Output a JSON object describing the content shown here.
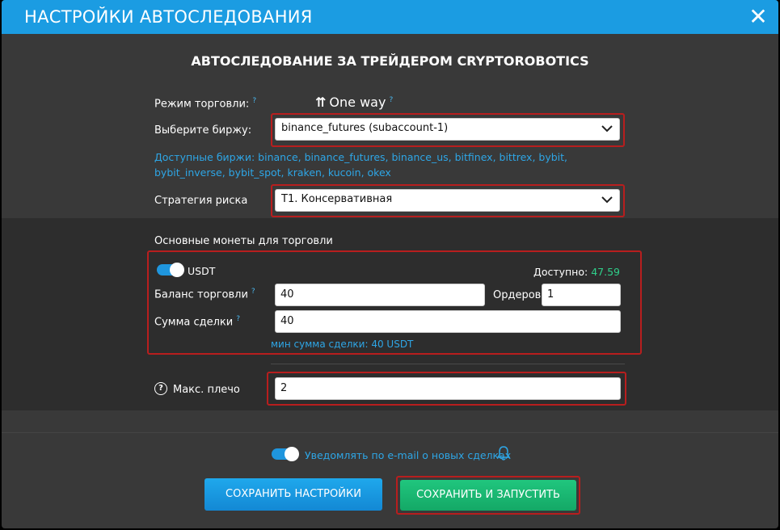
{
  "header": {
    "title": "НАСТРОЙКИ АВТОСЛЕДОВАНИЯ",
    "close_label": "✕"
  },
  "section_title": "АВТОСЛЕДОВАНИЕ ЗА ТРЕЙДЕРОМ CRYPTOROBOTICS",
  "trade_mode": {
    "label": "Режим торговли:",
    "help": "?",
    "value": "One way",
    "value_help": "?",
    "icon": "arrows-up-icon"
  },
  "exchange": {
    "label": "Выберите биржу:",
    "selected": "binance_futures (subaccount-1)",
    "available": "Доступные биржи: binance, binance_futures, binance_us, bitfinex, bittrex, bybit, bybit_inverse, bybit_spot, kraken, kucoin, okex"
  },
  "risk": {
    "label": "Стратегия риска",
    "selected": "T1. Консервативная"
  },
  "coins": {
    "title": "Основные монеты для торговли",
    "currency": "USDT",
    "enabled": true,
    "available_label": "Доступно:",
    "available_value": "47.59",
    "balance_label": "Баланс торговли",
    "balance_help": "?",
    "balance_value": "40",
    "orders_label": "Ордеров",
    "orders_value": "1",
    "deal_label": "Сумма сделки",
    "deal_help": "?",
    "deal_value": "40",
    "min_sum": "мин сумма сделки: 40 USDT"
  },
  "leverage": {
    "help_icon": "?",
    "label": "Макс. плечо",
    "value": "2"
  },
  "notify": {
    "label": "Уведомлять по e-mail о новых сделках",
    "enabled": true
  },
  "buttons": {
    "save": "СОХРАНИТЬ НАСТРОЙКИ",
    "save_run": "СОХРАНИТЬ И ЗАПУСТИТЬ"
  },
  "colors": {
    "accent": "#1b9ce2",
    "danger": "#b81e1e",
    "success": "#2fcf8a"
  }
}
